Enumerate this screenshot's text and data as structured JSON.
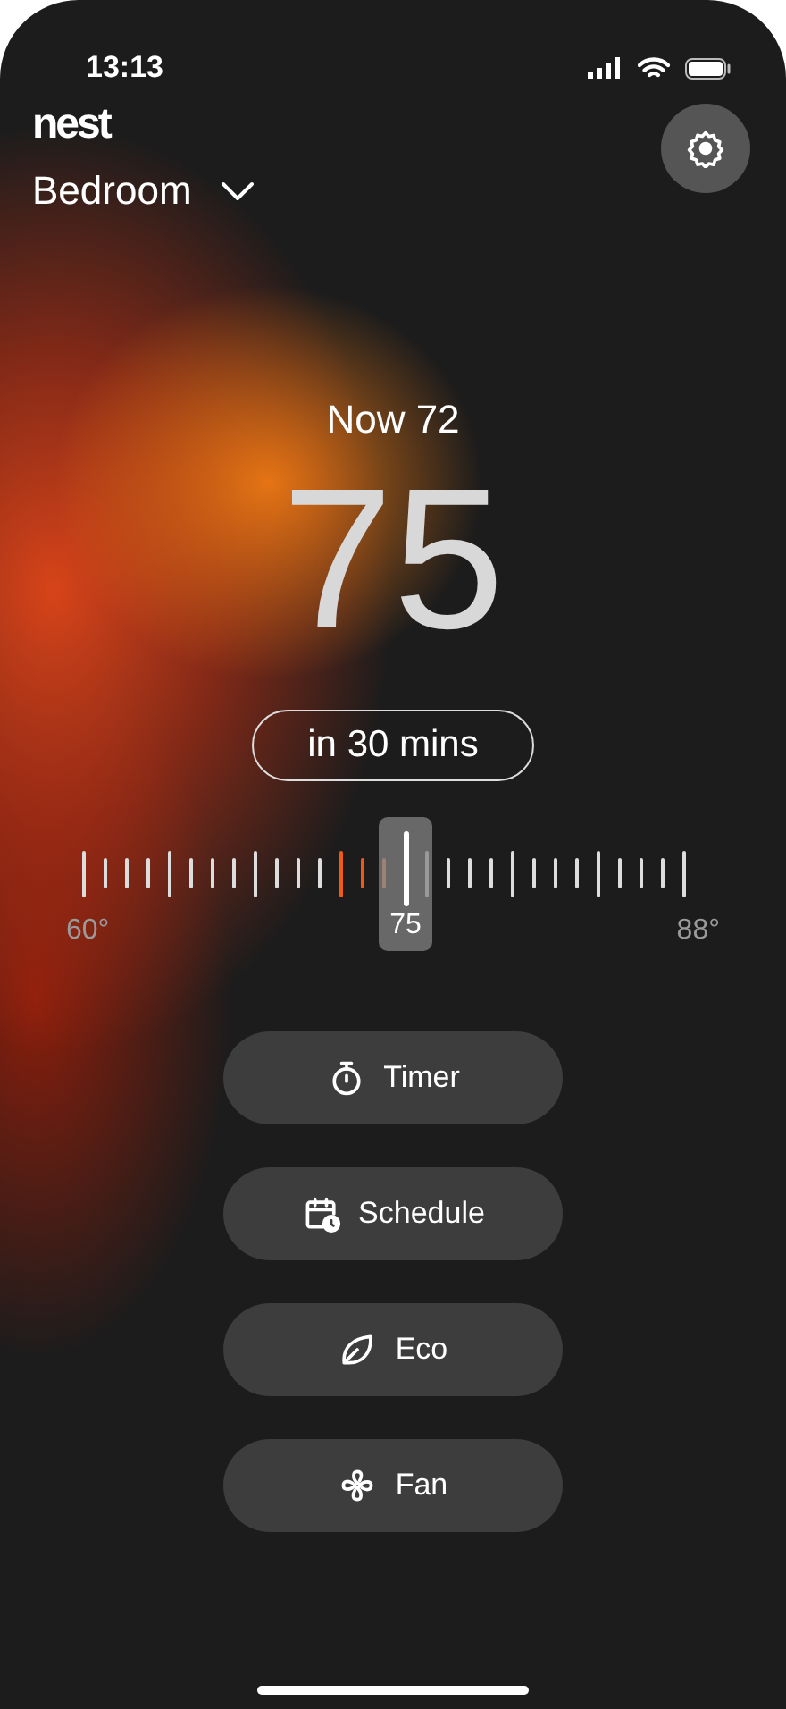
{
  "status_bar": {
    "time": "13:13"
  },
  "header": {
    "logo": "nest",
    "room": "Bedroom"
  },
  "current_temp": "Now 72",
  "target_temp": "75",
  "timer_pill": "in 30 mins",
  "slider": {
    "min_label": "60°",
    "max_label": "88°",
    "value_label": "75",
    "current": {
      "level": 0.4286
    }
  },
  "buttons": [
    {
      "kind": "timer",
      "label": "Timer"
    },
    {
      "kind": "schedule",
      "label": "Schedule"
    },
    {
      "kind": "eco",
      "label": "Eco"
    },
    {
      "kind": "fan",
      "label": "Fan"
    }
  ]
}
